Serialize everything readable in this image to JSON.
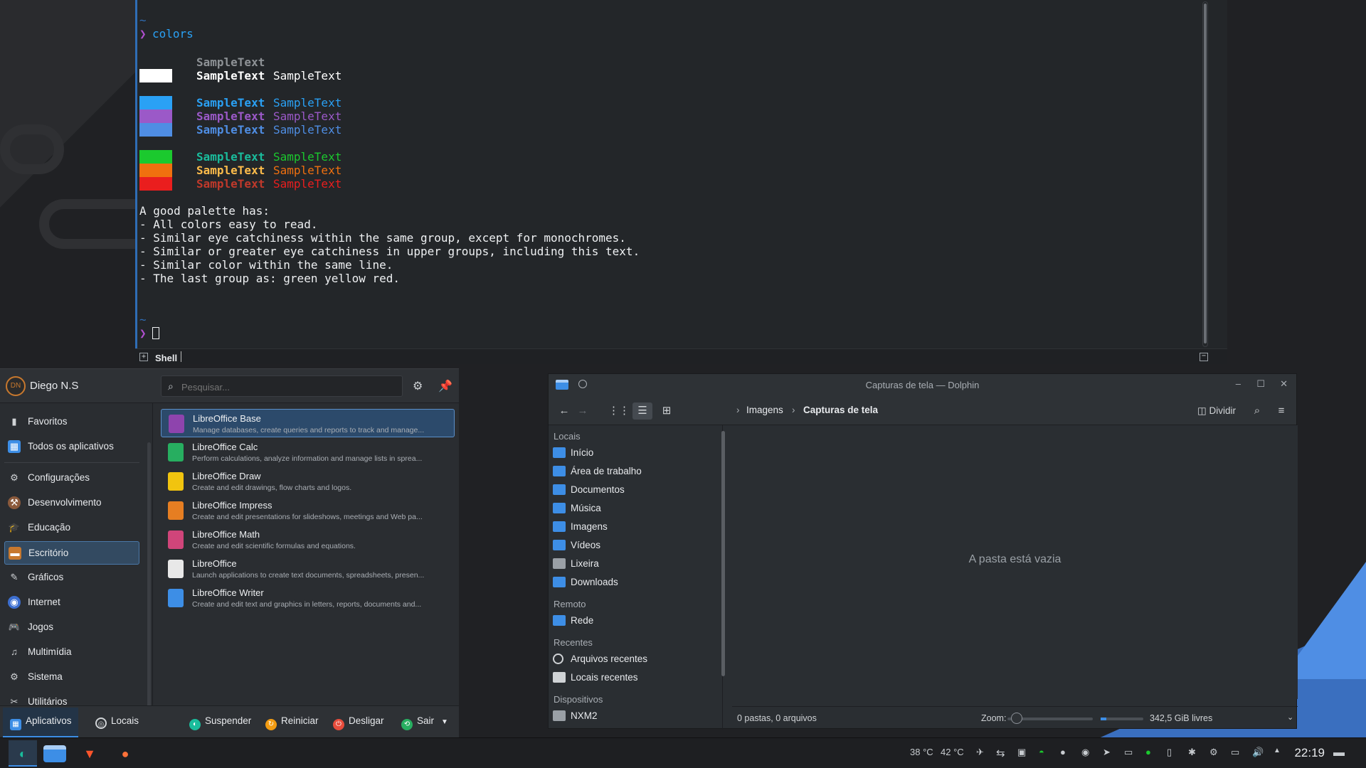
{
  "terminal": {
    "prompt_tilde": "~",
    "prompt_arrow": "❯",
    "command": "colors",
    "sample": "SampleText",
    "text_lines": [
      "A good palette has:",
      "- All colors easy to read.",
      "- Similar eye catchiness within the same group, except for monochromes.",
      "- Similar or greater eye catchiness in upper groups, including this text.",
      "- Similar color within the same line.",
      "- The last group as: green yellow red."
    ],
    "tab_label": "Shell",
    "colors": {
      "gray": "#8e9296",
      "white": "#ffffff",
      "blue": "#2aa1f5",
      "purple": "#9b59c8",
      "lightblue": "#4f8ee4",
      "green": "#1bc92e",
      "orange": "#f0700f",
      "red": "#ea1e1e",
      "teal": "#1abc9c",
      "yellow": "#fdbc4b",
      "darkred": "#c0392b"
    }
  },
  "launcher": {
    "user_initials": "DN",
    "user_name": "Diego N.S",
    "search_placeholder": "Pesquisar...",
    "categories": [
      {
        "label": "Favoritos",
        "icon": "bookmark-icon"
      },
      {
        "label": "Todos os aplicativos",
        "icon": "grid-icon"
      },
      {
        "label": "Configurações",
        "icon": "gear-icon"
      },
      {
        "label": "Desenvolvimento",
        "icon": "hammer-icon"
      },
      {
        "label": "Educação",
        "icon": "graduation-icon"
      },
      {
        "label": "Escritório",
        "icon": "briefcase-icon"
      },
      {
        "label": "Gráficos",
        "icon": "graphics-icon"
      },
      {
        "label": "Internet",
        "icon": "globe-icon"
      },
      {
        "label": "Jogos",
        "icon": "gamepad-icon"
      },
      {
        "label": "Multimídia",
        "icon": "multimedia-icon"
      },
      {
        "label": "Sistema",
        "icon": "system-gear-icon"
      },
      {
        "label": "Utilitários",
        "icon": "utilities-icon"
      }
    ],
    "apps": [
      {
        "title": "LibreOffice Base",
        "desc": "Manage databases, create queries and reports to track and manage...",
        "color": "#8e44ad"
      },
      {
        "title": "LibreOffice Calc",
        "desc": "Perform calculations, analyze information and manage lists in sprea...",
        "color": "#27ae60"
      },
      {
        "title": "LibreOffice Draw",
        "desc": "Create and edit drawings, flow charts and logos.",
        "color": "#f1c40f"
      },
      {
        "title": "LibreOffice Impress",
        "desc": "Create and edit presentations for slideshows, meetings and Web pa...",
        "color": "#e67e22"
      },
      {
        "title": "LibreOffice Math",
        "desc": "Create and edit scientific formulas and equations.",
        "color": "#d0457a"
      },
      {
        "title": "LibreOffice",
        "desc": "Launch applications to create text documents, spreadsheets, presen...",
        "color": "#e8e8e8"
      },
      {
        "title": "LibreOffice Writer",
        "desc": "Create and edit text and graphics in letters, reports, documents and...",
        "color": "#3d8ee6"
      }
    ],
    "footer": {
      "apps": "Aplicativos",
      "places": "Locais",
      "suspend": "Suspender",
      "restart": "Reiniciar",
      "shutdown": "Desligar",
      "logout": "Sair"
    }
  },
  "dolphin": {
    "title": "Capturas de tela — Dolphin",
    "breadcrumb": [
      "Imagens",
      "Capturas de tela"
    ],
    "split_label": "Dividir",
    "places": {
      "local_header": "Locais",
      "local": [
        "Início",
        "Área de trabalho",
        "Documentos",
        "Música",
        "Imagens",
        "Vídeos",
        "Lixeira",
        "Downloads"
      ],
      "remote_header": "Remoto",
      "remote": [
        "Rede"
      ],
      "recent_header": "Recentes",
      "recent": [
        "Arquivos recentes",
        "Locais recentes"
      ],
      "devices_header": "Dispositivos",
      "devices": [
        "NXM2"
      ]
    },
    "empty_text": "A pasta está vazia",
    "status": "0 pastas, 0 arquivos",
    "zoom_label": "Zoom:",
    "free_space": "342,5 GiB livres"
  },
  "taskbar": {
    "temp_cpu": "38 °C",
    "temp_gpu": "42 °C",
    "time": "22:19"
  }
}
